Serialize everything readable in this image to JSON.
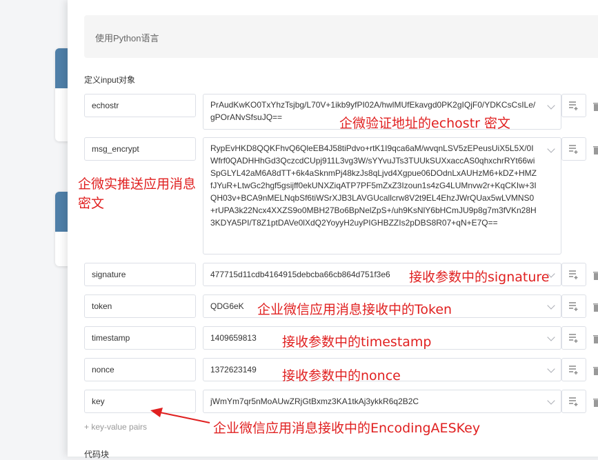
{
  "language_box": {
    "text": "使用Python语言"
  },
  "section_input_label": "定义input对象",
  "rows": [
    {
      "key": "echostr",
      "value": "PrAudKwKO0TxYhzTsjbg/L70V+1ikb9yfPI02A/hwlMUfEkavgd0PK2gIQjF0/YDKCsCsILe/gPOrANvSfsuJQ=="
    },
    {
      "key": "msg_encrypt",
      "value": "RypEvHKD8QQKFhvQ6QleEB4J58tiPdvo+rtK1I9qca6aM/wvqnLSV5zEPeusUiX5L5X/0IWfrf0QADHHhGd3QczcdCUpj911L3vg3W/sYYvuJTs3TUUkSUXxaccAS0qhxchrRYt66wiSpGLYL42aM6A8dTT+6k4aSknmPj48kzJs8qLjvd4Xgpue06DOdnLxAUHzM6+kDZ+HMZfJYuR+LtwGc2hgf5gsijff0ekUNXZiqATP7PF5mZxZ3Izoun1s4zG4LUMnvw2r+KqCKIw+3IQH03v+BCA9nMELNqbSf6tiWSrXJB3LAVGUcallcrw8V2t9EL4EhzJWrQUax5wLVMNS0+rUPA3k22Ncx4XXZS9o0MBH27Bo6BpNelZpS+/uh9KsNlY6bHCmJU9p8g7m3fVKn28H3KDYA5PI/T8Z1ptDAVe0lXdQ2YoyyH2uyPIGHBZZIs2pDBS8R07+qN+E7Q=="
    },
    {
      "key": "signature",
      "value": "477715d11cdb4164915debcba66cb864d751f3e6"
    },
    {
      "key": "token",
      "value": "QDG6eK"
    },
    {
      "key": "timestamp",
      "value": "1409659813"
    },
    {
      "key": "nonce",
      "value": "1372623149"
    },
    {
      "key": "key",
      "value": "jWmYm7qr5nMoAUwZRjGtBxmz3KA1tkAj3ykkR6q2B2C"
    }
  ],
  "add_pairs_link": "+ key-value pairs",
  "code_block_label": "代码块",
  "annotations": {
    "echostr": "企微验证地址的echostr 密文",
    "msg_encrypt_line1": "企微实推送应用消息",
    "msg_encrypt_line2": "密文",
    "signature": "接收参数中的signature",
    "token": "企业微信应用消息接收中的Token",
    "timestamp": "接收参数中的timestamp",
    "nonce": "接收参数中的nonce",
    "key": "企业微信应用消息接收中的EncodingAESKey"
  },
  "colors": {
    "annotation": "#e02020",
    "border": "#dcdfe6",
    "bg_card_bar": "#4f7fa8"
  }
}
